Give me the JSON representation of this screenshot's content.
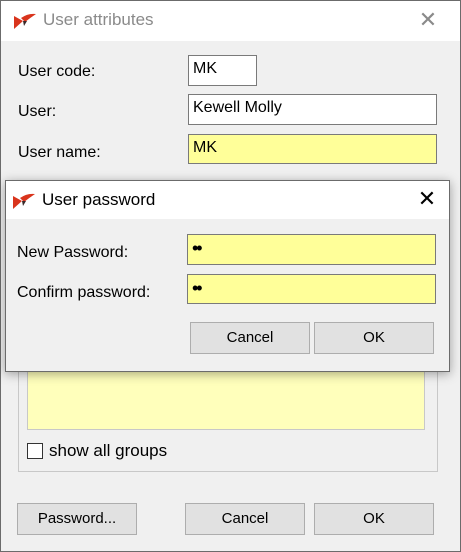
{
  "parent": {
    "title": "User attributes",
    "close_glyph": "✕",
    "fields": {
      "user_code_label": "User code:",
      "user_code_value": "MK",
      "user_label": "User:",
      "user_value": "Kewell Molly",
      "user_name_label": "User name:",
      "user_name_value": "MK"
    },
    "show_all_groups_label": "show all groups",
    "show_all_groups_checked": false,
    "buttons": {
      "password": "Password...",
      "cancel": "Cancel",
      "ok": "OK"
    }
  },
  "password_dialog": {
    "title": "User password",
    "close_glyph": "✕",
    "new_password_label": "New Password:",
    "new_password_value": "••",
    "confirm_password_label": "Confirm password:",
    "confirm_password_value": "••",
    "buttons": {
      "cancel": "Cancel",
      "ok": "OK"
    }
  },
  "colors": {
    "required_field": "#ffff99",
    "logo_red": "#d9341c",
    "logo_dark": "#3a2a2a"
  },
  "icons": [
    "app-logo-icon",
    "close-icon",
    "checkbox-icon"
  ]
}
